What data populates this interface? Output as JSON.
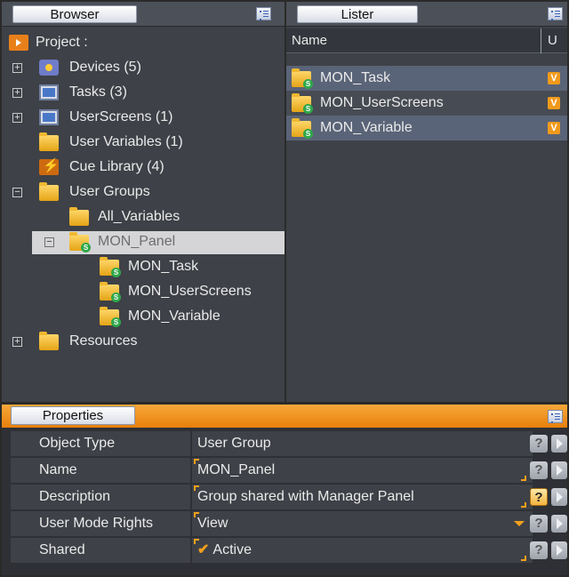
{
  "browser": {
    "title": "Browser",
    "root": "Project :",
    "items": [
      {
        "label": "Devices (5)"
      },
      {
        "label": "Tasks (3)"
      },
      {
        "label": "UserScreens (1)"
      },
      {
        "label": "User Variables (1)"
      },
      {
        "label": "Cue Library (4)"
      },
      {
        "label": "User Groups"
      },
      {
        "label": "All_Variables"
      },
      {
        "label": "MON_Panel"
      },
      {
        "label": "MON_Task"
      },
      {
        "label": "MON_UserScreens"
      },
      {
        "label": "MON_Variable"
      },
      {
        "label": "Resources"
      }
    ]
  },
  "lister": {
    "title": "Lister",
    "col_name": "Name",
    "col_u": "U",
    "badge": "V",
    "rows": [
      {
        "label": "MON_Task"
      },
      {
        "label": "MON_UserScreens"
      },
      {
        "label": "MON_Variable"
      }
    ]
  },
  "properties": {
    "title": "Properties",
    "rows": [
      {
        "name": "Object Type",
        "value": "User Group"
      },
      {
        "name": "Name",
        "value": "MON_Panel"
      },
      {
        "name": "Description",
        "value": "Group shared with Manager Panel"
      },
      {
        "name": "User Mode Rights",
        "value": "View"
      },
      {
        "name": "Shared",
        "value": "Active"
      }
    ],
    "help_glyph": "?"
  },
  "colors": {
    "accent_orange": "#f3a01c",
    "panel_bg": "#3e4147",
    "selection_bg": "#d5d5d8"
  },
  "icons": [
    "play-icon",
    "devices-icon",
    "tasks-icon",
    "userscreens-icon",
    "variables-folder-icon",
    "cue-bolt-icon",
    "folder-icon",
    "shared-folder-icon",
    "menu-icon",
    "help-icon",
    "arrow-right-icon",
    "dropdown-icon",
    "checkmark-icon"
  ]
}
